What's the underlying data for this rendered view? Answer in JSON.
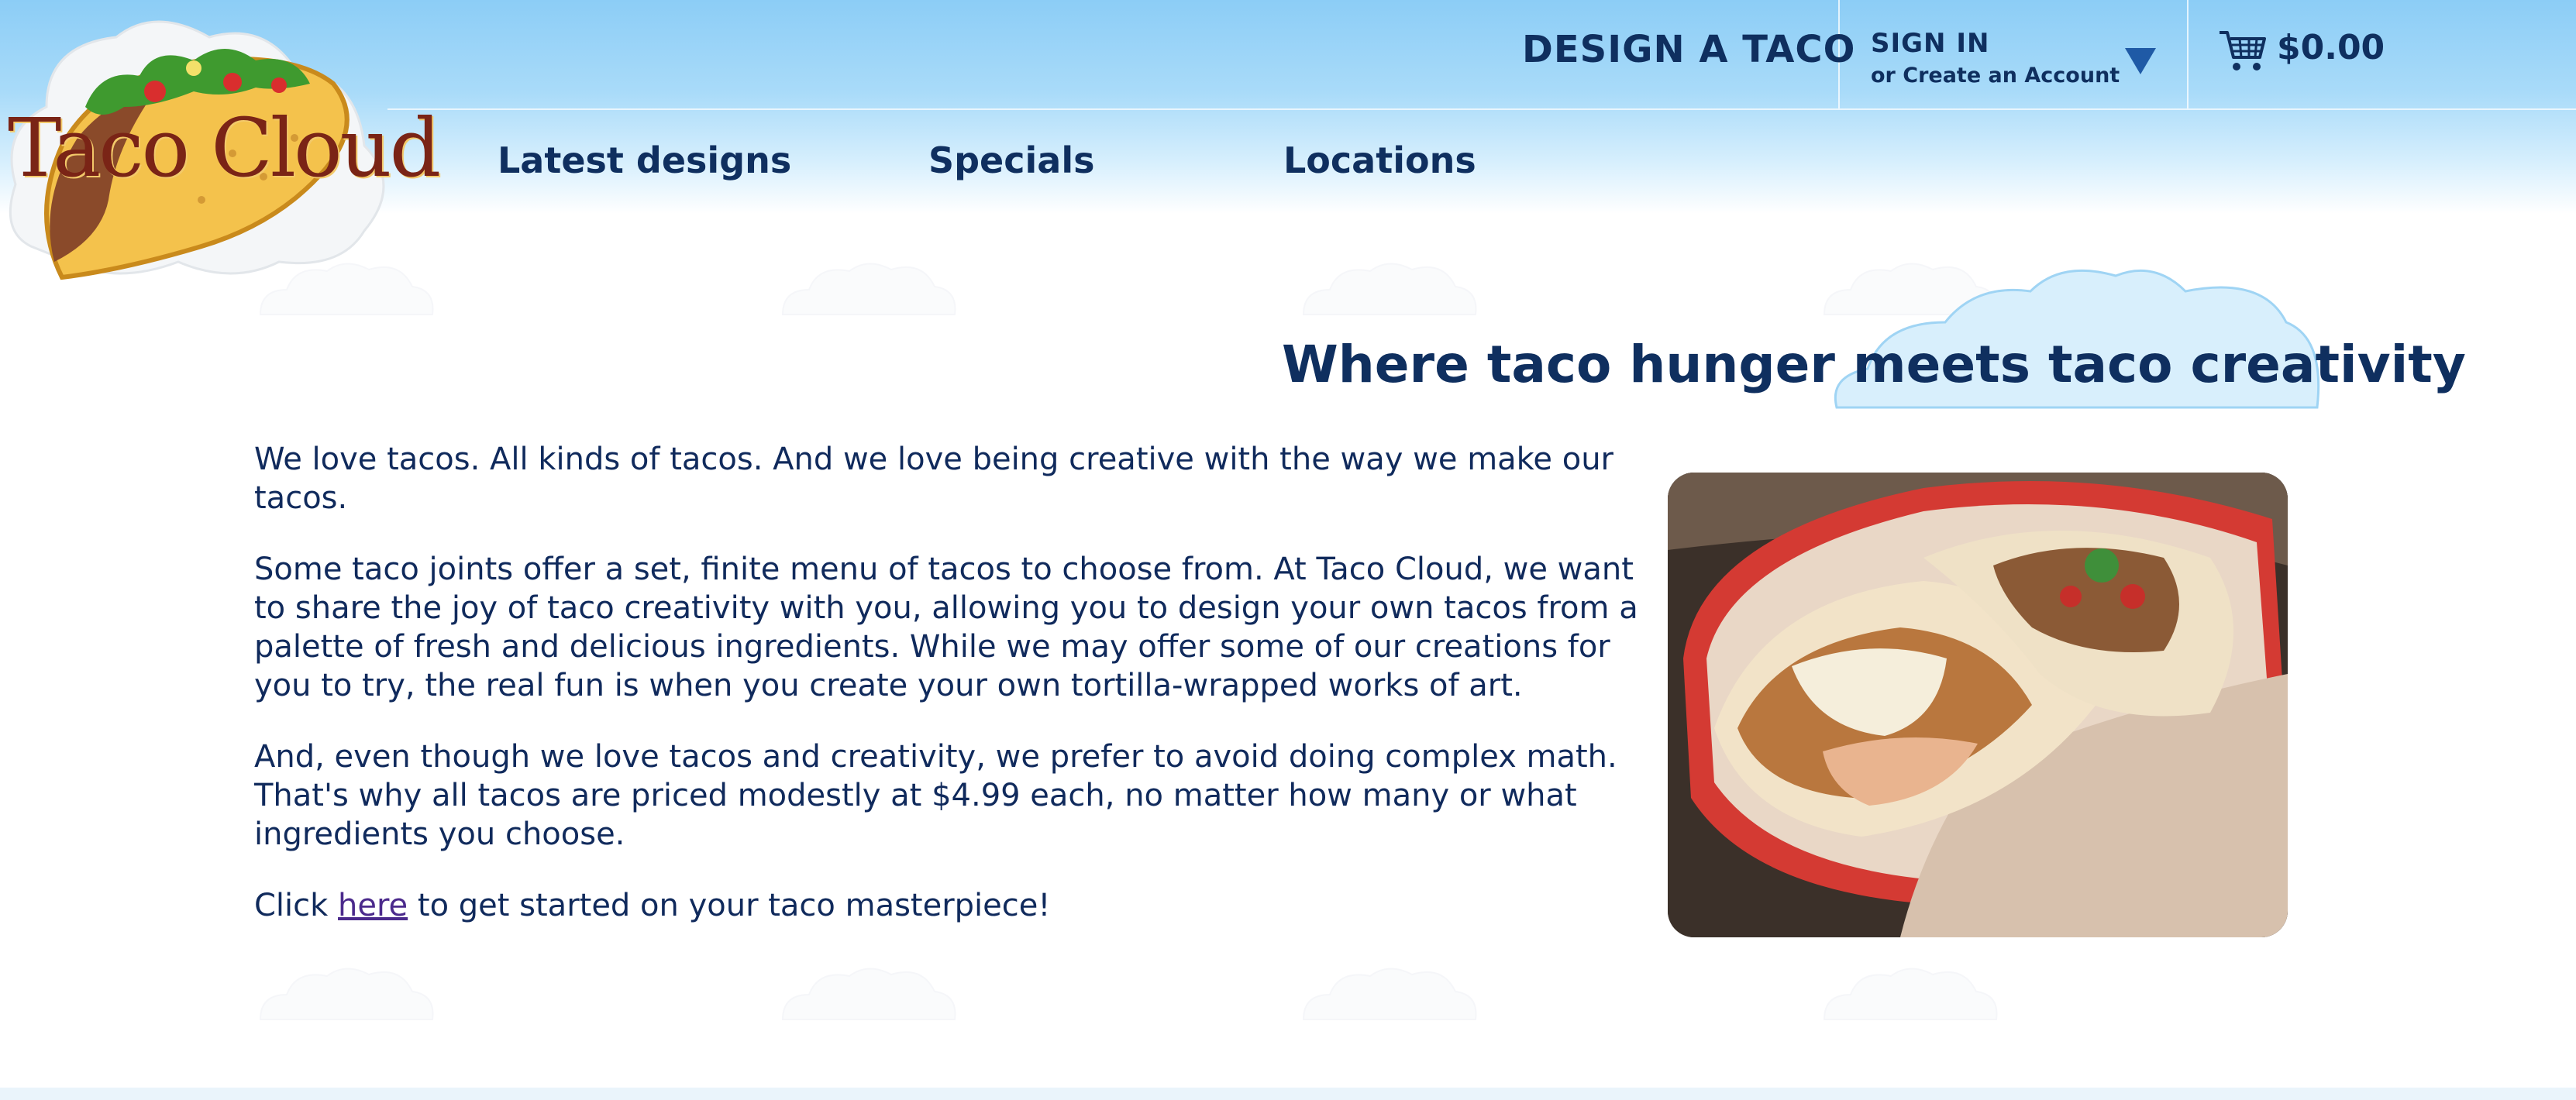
{
  "brand": {
    "logo_text": "Taco Cloud"
  },
  "header": {
    "design_link": "DESIGN A TACO",
    "signin": "SIGN IN",
    "create_account": "or Create an Account",
    "cart_total": "$0.00"
  },
  "nav": {
    "items": [
      "Latest designs",
      "Specials",
      "Locations"
    ]
  },
  "main": {
    "headline": "Where taco hunger meets taco creativity",
    "paragraph1": "We love tacos. All kinds of tacos. And we love being creative with the way we make our tacos.",
    "paragraph2": "Some taco joints offer a set, finite menu of tacos to choose from. At Taco Cloud, we want to share the joy of taco creativity with you, allowing you to design your own tacos from a palette of fresh and delicious ingredients. While we may offer some of our creations for you to try, the real fun is when you create your own tortilla-wrapped works of art.",
    "paragraph3": "And, even though we love tacos and creativity, we prefer to avoid doing complex math. That's why all tacos are priced modestly at $4.99 each, no matter how many or what ingredients you choose.",
    "cta_prefix": "Click",
    "cta_link": "here",
    "cta_suffix": "to get started on your taco masterpiece!"
  },
  "colors": {
    "primary_text": "#0f2f5f",
    "header_top": "#8ccdf6",
    "link_visited": "#4b2a8c",
    "dropdown_arrow": "#1f5aa6"
  },
  "icons": {
    "cart": "shopping-cart-icon",
    "dropdown": "triangle-down-icon"
  }
}
